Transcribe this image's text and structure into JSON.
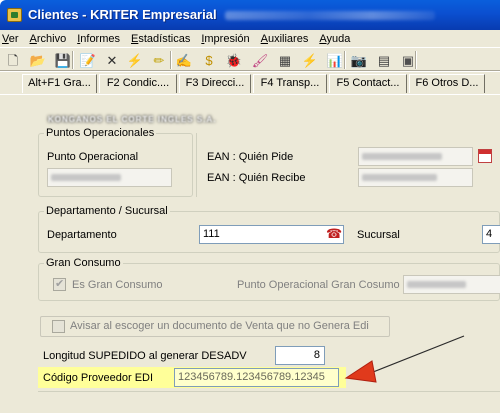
{
  "window": {
    "title": "Clientes - KRITER Empresarial"
  },
  "menu": [
    "Ver",
    "Archivo",
    "Informes",
    "Estadísticas",
    "Impresión",
    "Auxiliares",
    "Ayuda"
  ],
  "menu_underline": [
    "V",
    "A",
    "I",
    "E",
    "I",
    "A",
    "A"
  ],
  "toolbar": {
    "icons": [
      "new-doc-icon",
      "open-folder-icon",
      "save-icon",
      "edit-icon",
      "delete-icon",
      "sparkle-icon",
      "wand-icon",
      "brush-icon",
      "coins-icon",
      "bug-icon",
      "paint-icon",
      "grid-icon",
      "lightning-icon",
      "bar-chart-icon",
      "camera-icon",
      "calculator-icon",
      "box-icon"
    ],
    "glyphs": [
      "🗋",
      "📂",
      "💾",
      "📝",
      "✕",
      "⚡",
      "✏",
      "✍",
      "$",
      "🐞",
      "🖌",
      "▦",
      "⚡",
      "📊",
      "📷",
      "▤",
      "▣"
    ]
  },
  "tabs": [
    "Alt+F1 Gra...",
    "F2 Condic....",
    "F3 Direcci...",
    "F4 Transp...",
    "F5 Contact...",
    "F6 Otros D..."
  ],
  "client_name": "KONGANOS     EL CORTE INGLES S.A.",
  "puntos_operacionales": {
    "legend": "Puntos Operacionales",
    "punto_operacional_label": "Punto Operacional",
    "ean_pide_label": "EAN : Quién Pide",
    "ean_recibe_label": "EAN : Quién Recibe"
  },
  "departamento_sucursal": {
    "legend": "Departamento / Sucursal",
    "departamento_label": "Departamento",
    "departamento_value": "111",
    "sucursal_label": "Sucursal",
    "sucursal_value": "4"
  },
  "gran_consumo": {
    "legend": "Gran Consumo",
    "es_gran_consumo_label": "Es Gran Consumo",
    "es_gran_consumo_checked": true,
    "punto_operacional_gc_label": "Punto Operacional Gran Cosumo"
  },
  "avisar": {
    "label": "Avisar al escoger un documento de Venta que no Genera Edi",
    "checked": false
  },
  "longitud": {
    "label": "Longitud SUPEDIDO al generar DESADV",
    "value": "8"
  },
  "codigo_proveedor": {
    "label": "Código Proveedor EDI",
    "value": "123456789.123456789.12345"
  },
  "colors": {
    "highlight": "#ffff99",
    "arrow": "#e03a1c"
  }
}
